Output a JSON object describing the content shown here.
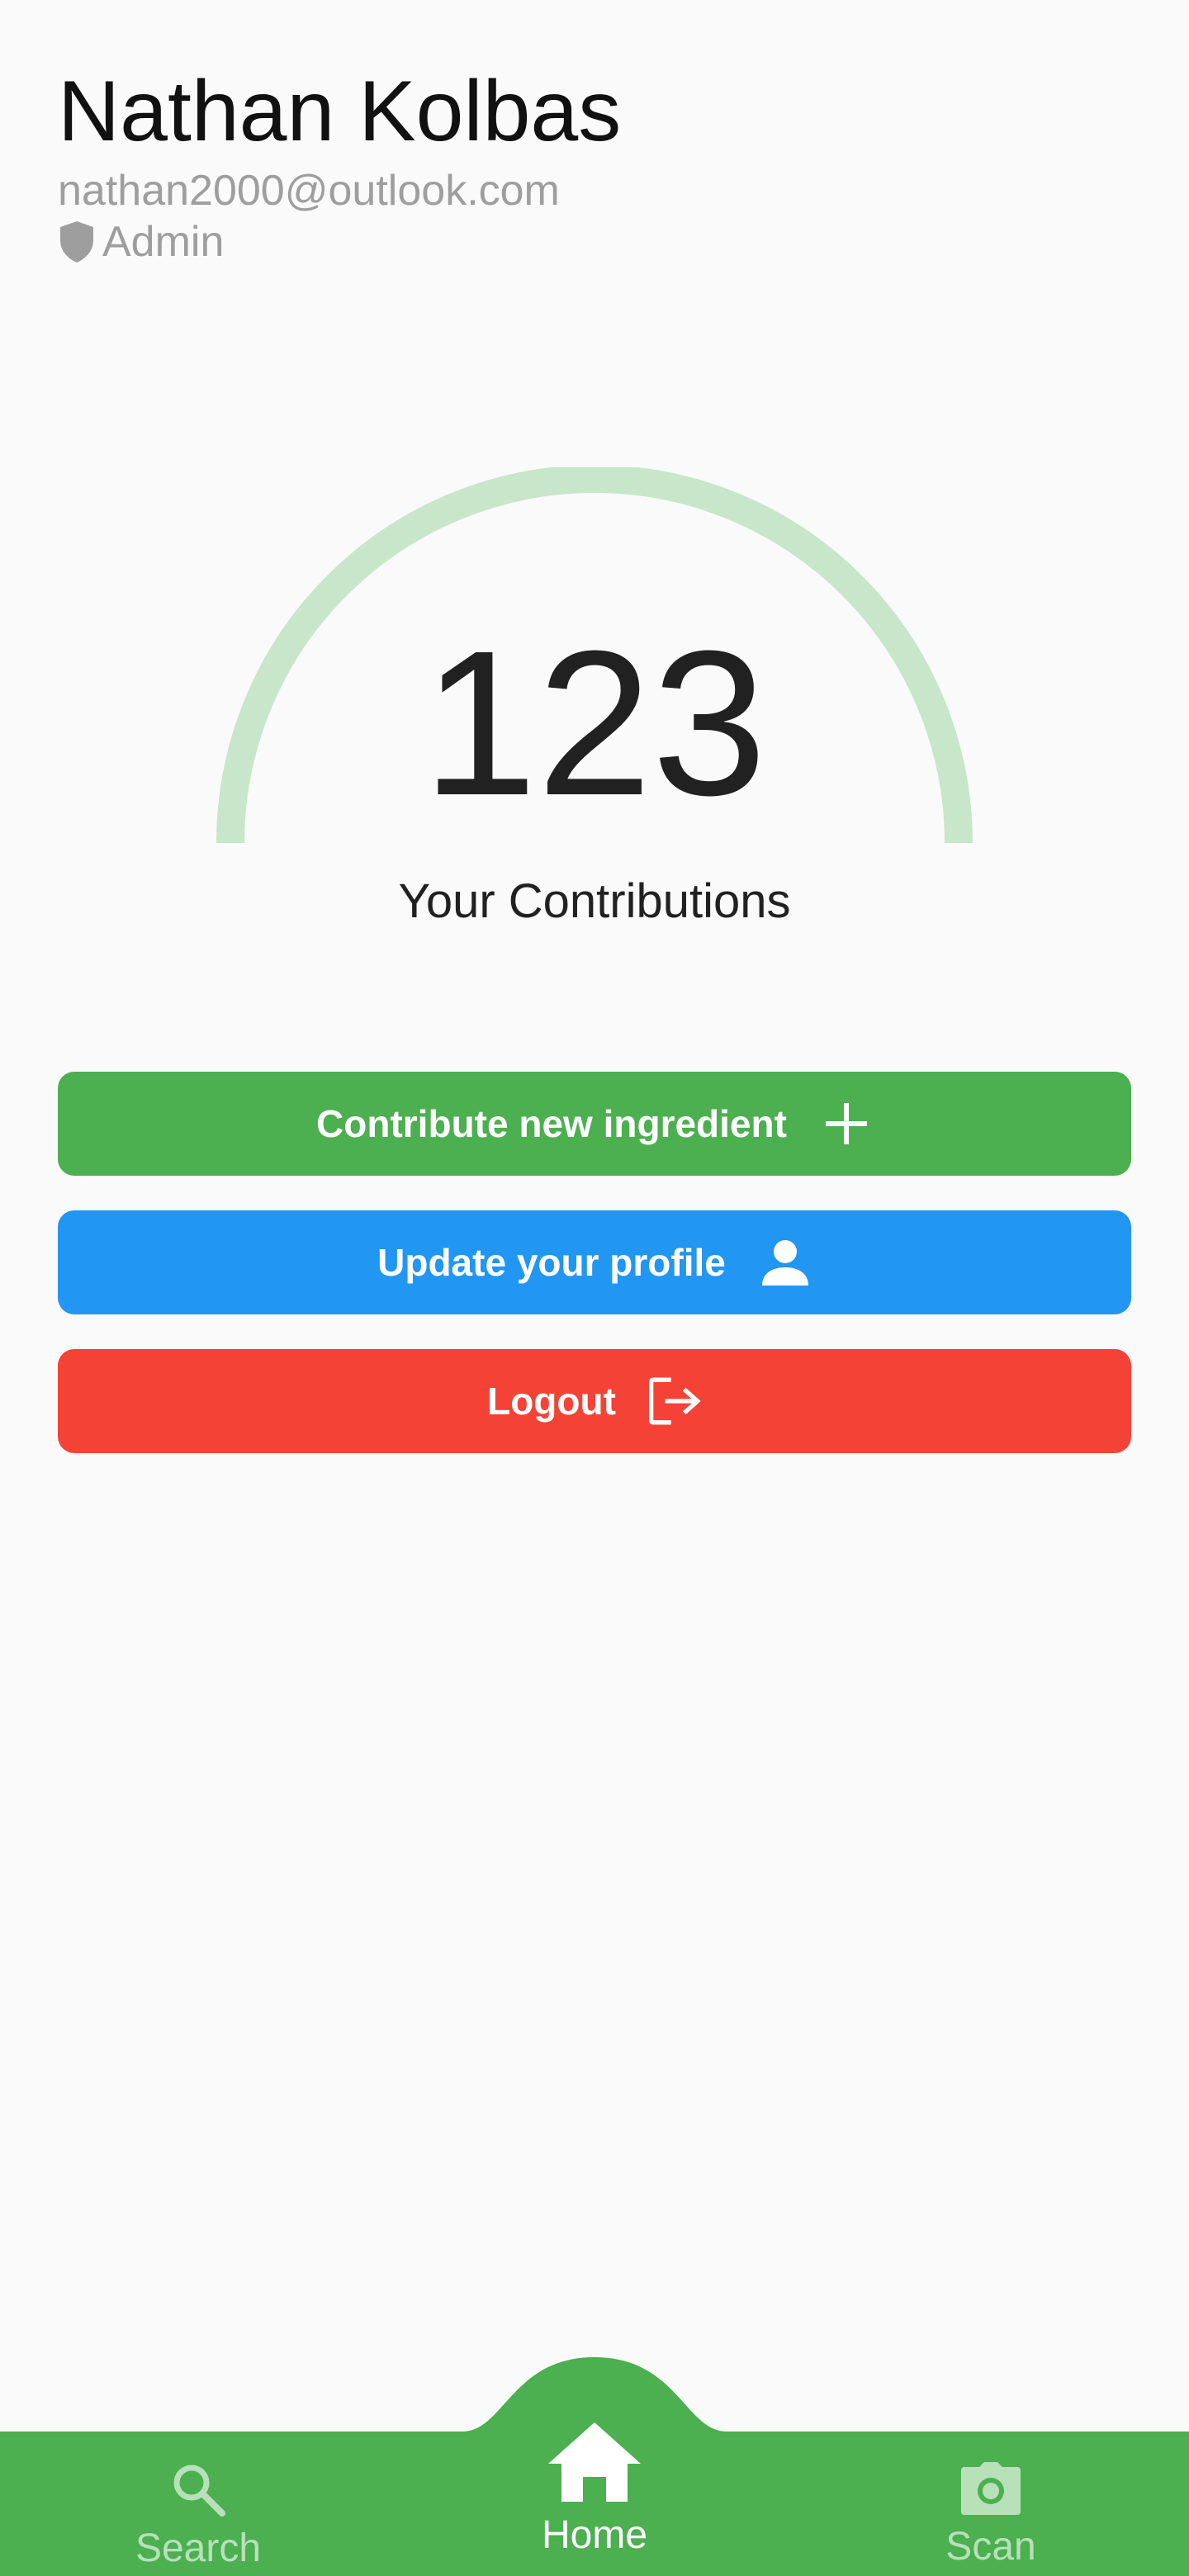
{
  "profile": {
    "name": "Nathan Kolbas",
    "email": "nathan2000@outlook.com",
    "role": "Admin",
    "role_icon": "shield-icon"
  },
  "contributions": {
    "count": "123",
    "label": "Your Contributions"
  },
  "actions": [
    {
      "label": "Contribute new ingredient",
      "icon": "plus-icon",
      "color": "#4caf50"
    },
    {
      "label": "Update your profile",
      "icon": "person-icon",
      "color": "#2196f3"
    },
    {
      "label": "Logout",
      "icon": "logout-icon",
      "color": "#f44336"
    }
  ],
  "bottom_nav": {
    "background": "#4caf50",
    "items": [
      {
        "label": "Search",
        "icon": "search-icon",
        "active": false
      },
      {
        "label": "Home",
        "icon": "home-icon",
        "active": true
      },
      {
        "label": "Scan",
        "icon": "camera-icon",
        "active": false
      }
    ]
  },
  "colors": {
    "gauge_track": "#c8e6c9",
    "muted_text": "#9e9e9e",
    "background": "#fafafa"
  }
}
